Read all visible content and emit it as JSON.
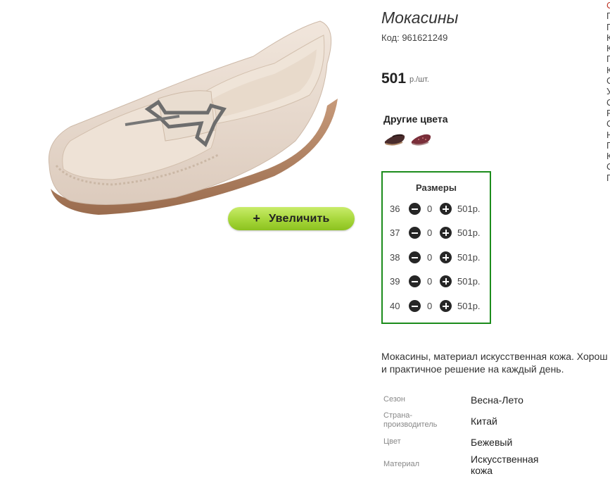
{
  "product": {
    "title": "Мокасины",
    "sku": "Код: 961621249",
    "price": "501",
    "price_unit": "р./шт.",
    "zoom_button": "Увеличить",
    "zoom_plus": "+",
    "other_colors_label": "Другие цвета"
  },
  "sizes": {
    "title": "Размеры",
    "rows": [
      {
        "size": "36",
        "qty": "0",
        "price": "501р."
      },
      {
        "size": "37",
        "qty": "0",
        "price": "501р."
      },
      {
        "size": "38",
        "qty": "0",
        "price": "501р."
      },
      {
        "size": "39",
        "qty": "0",
        "price": "501р."
      },
      {
        "size": "40",
        "qty": "0",
        "price": "501р."
      }
    ]
  },
  "description": {
    "line1": "Мокасины, материал искусственная кожа. Хорош",
    "line2": "и практичное решение на каждый день."
  },
  "specs": [
    {
      "label": "Сезон",
      "value": "Весна-Лето"
    },
    {
      "label": "Страна-производитель",
      "label_line1": "Страна-",
      "label_line2": "производитель",
      "value": "Китай"
    },
    {
      "label": "Цвет",
      "value": "Бежевый"
    },
    {
      "label": "Материал",
      "value": "Искусственная кожа",
      "value_line1": "Искусственная",
      "value_line2": "кожа"
    }
  ],
  "edge_letters": [
    "С",
    "П",
    "П",
    "К",
    "К",
    "П",
    "К",
    "С",
    "У",
    "С",
    "Р",
    "С",
    "Н",
    "П",
    "К",
    "С",
    "П"
  ],
  "colors": {
    "accent_green": "#1c8c1c",
    "button_green": "#a6d63a",
    "edge_first": "#c0392b"
  },
  "icons": [
    "minus-icon",
    "plus-icon"
  ]
}
